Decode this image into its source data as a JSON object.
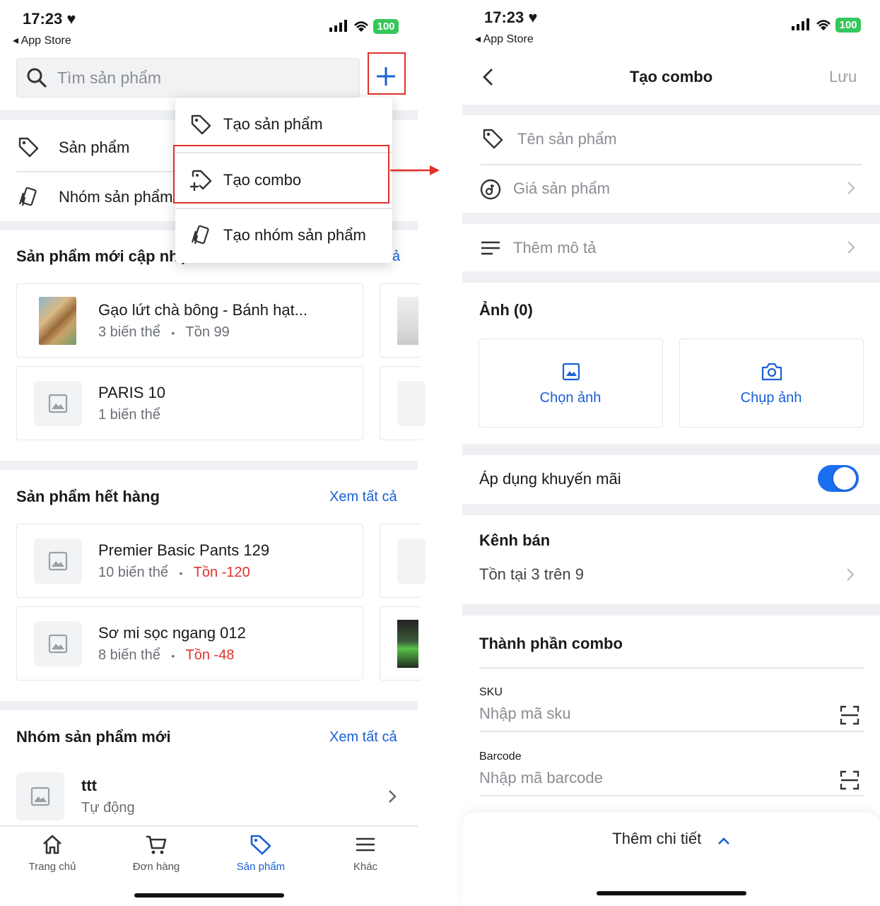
{
  "left": {
    "status_time": "17:23",
    "back_app": "App Store",
    "battery": "100",
    "search_placeholder": "Tìm sản phẩm",
    "menu": {
      "create_product": "Tạo sản phẩm",
      "create_combo": "Tạo combo",
      "create_group": "Tạo nhóm sản phẩm"
    },
    "list_items": {
      "products": "Sản phẩm",
      "groups": "Nhóm sản phẩm"
    },
    "recent": {
      "title": "Sản phẩm mới cập nhật",
      "view_all_fragment": "ả",
      "items": [
        {
          "name": "Gạo lứt chà bông - Bánh hạt...",
          "variants": "3  biến thể",
          "dot": "•",
          "stock": "Tồn 99"
        },
        {
          "name": "PARIS 10",
          "variants": "1  biến thể"
        }
      ]
    },
    "out_of_stock": {
      "title": "Sản phẩm hết hàng",
      "view_all": "Xem tất cả",
      "items": [
        {
          "name": "Premier Basic Pants 129",
          "variants": "10  biến thể",
          "dot": "•",
          "stock": "Tồn -120"
        },
        {
          "name": "Sơ mi sọc ngang 012",
          "variants": "8  biến thể",
          "dot": "•",
          "stock": "Tồn -48"
        }
      ]
    },
    "new_groups": {
      "title": "Nhóm sản phẩm mới",
      "view_all": "Xem tất cả",
      "items": [
        {
          "name": "ttt",
          "type": "Tự động"
        }
      ]
    },
    "tabs": [
      {
        "label": "Trang chủ",
        "icon": "home-icon"
      },
      {
        "label": "Đơn hàng",
        "icon": "cart-icon"
      },
      {
        "label": "Sản phẩm",
        "icon": "tag-icon"
      },
      {
        "label": "Khác",
        "icon": "menu-icon"
      }
    ]
  },
  "right": {
    "status_time": "17:23",
    "back_app": "App Store",
    "battery": "100",
    "title": "Tạo combo",
    "save": "Lưu",
    "name_placeholder": "Tên sản phẩm",
    "price_placeholder": "Giá sản phẩm",
    "desc_placeholder": "Thêm mô tả",
    "photos_title": "Ảnh (0)",
    "choose_photo": "Chọn ảnh",
    "take_photo": "Chụp ảnh",
    "promo_label": "Áp dụng khuyến mãi",
    "promo_on": true,
    "channels_title": "Kênh bán",
    "channels_value": "Tồn tại 3 trên 9",
    "components_title": "Thành phần combo",
    "sku_label": "SKU",
    "sku_placeholder": "Nhập mã sku",
    "barcode_label": "Barcode",
    "barcode_placeholder": "Nhập mã barcode",
    "more_details": "Thêm chi tiết"
  },
  "colors": {
    "accent": "#1a5fd6",
    "danger": "#e0312b",
    "band": "#eef0f3",
    "toggle": "#1a6ff0",
    "battery": "#34c759"
  }
}
